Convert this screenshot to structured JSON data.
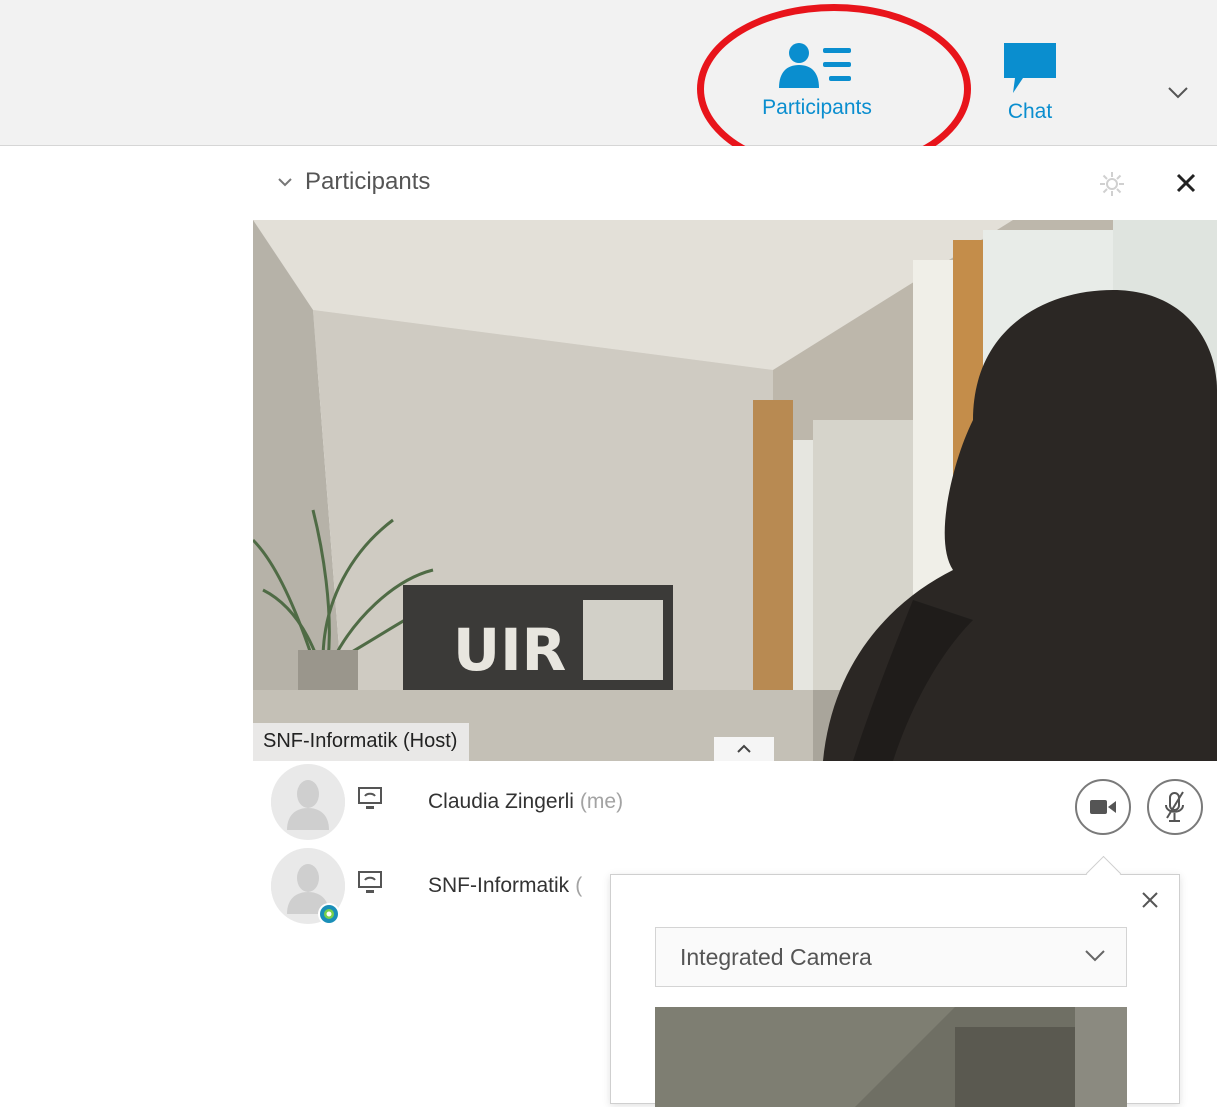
{
  "toolbar": {
    "participants_label": "Participants",
    "chat_label": "Chat",
    "accent_color": "#0a8ecf",
    "more_icon": "chevron-down-icon"
  },
  "annotation": {
    "highlight_color": "#e8141b"
  },
  "panel": {
    "title": "Participants",
    "settings_icon": "gear-icon",
    "close_icon": "close-icon"
  },
  "video": {
    "name_label": "SNF-Informatik (Host)",
    "toggle_icon": "chevron-up-icon"
  },
  "participants": [
    {
      "name": "Claudia Zingerli",
      "suffix": "(me)",
      "icons": [
        "avatar",
        "screen-share-icon"
      ]
    },
    {
      "name": "SNF-Informatik",
      "suffix": "(",
      "icons": [
        "avatar",
        "presence-icon",
        "screen-share-icon"
      ]
    }
  ],
  "controls": {
    "camera_icon": "video-camera-icon",
    "mic_icon": "mic-muted-icon"
  },
  "camera_popup": {
    "selected_camera": "Integrated Camera",
    "close_icon": "close-icon"
  }
}
